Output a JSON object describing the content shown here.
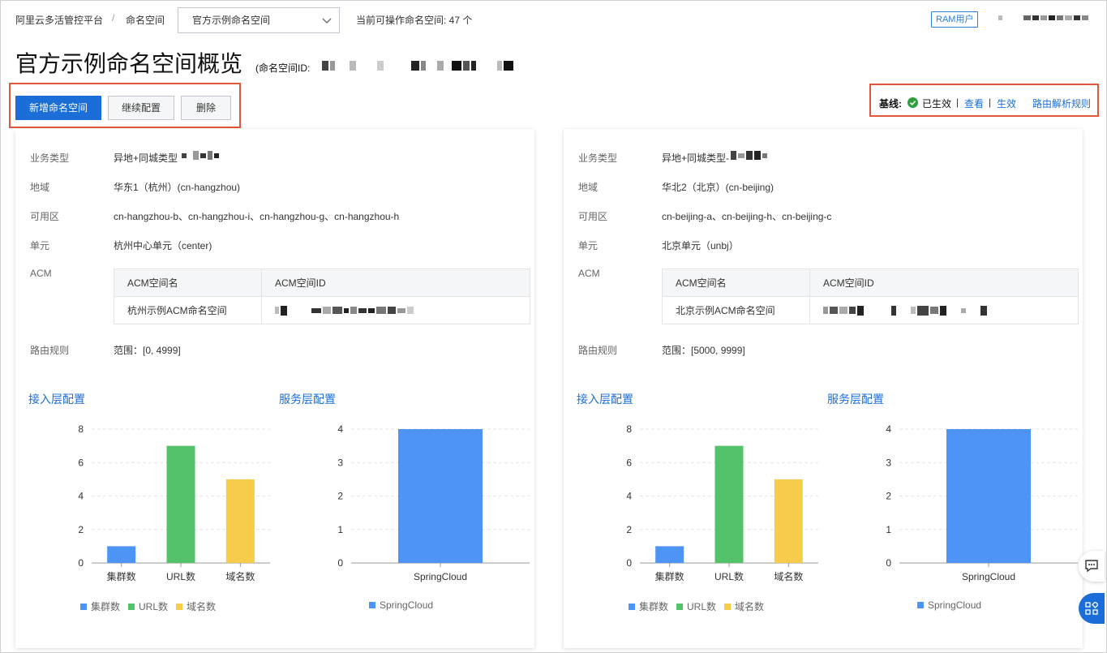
{
  "breadcrumb": {
    "platform": "阿里云多活管控平台",
    "separator": "/",
    "section": "命名空间"
  },
  "ns_select": {
    "value": "官方示例命名空间"
  },
  "count_label": "当前可操作命名空间: 47 个",
  "user": {
    "role_badge": "RAM用户"
  },
  "page_title": "官方示例命名空间概览",
  "ns_id_label": "(命名空间ID:",
  "actions": {
    "add": "新增命名空间",
    "continue": "继续配置",
    "delete": "删除"
  },
  "baseline": {
    "label": "基线:",
    "status": "已生效",
    "sep": "|",
    "view": "查看",
    "apply": "生效",
    "route_rules": "路由解析规则",
    "status_color": "#2e9e3e"
  },
  "labels": {
    "biz_type": "业务类型",
    "region": "地域",
    "zone": "可用区",
    "unit": "单元",
    "acm": "ACM",
    "route": "路由规则",
    "acm_name_col": "ACM空间名",
    "acm_id_col": "ACM空间ID",
    "access_title": "接入层配置",
    "service_title": "服务层配置"
  },
  "cards": [
    {
      "biz_type": "异地+同城类型",
      "region": "华东1（杭州）(cn-hangzhou)",
      "zone": "cn-hangzhou-b、cn-hangzhou-i、cn-hangzhou-g、cn-hangzhou-h",
      "unit": "杭州中心单元（center)",
      "acm_name": "杭州示例ACM命名空间",
      "route": "范围：[0, 4999]"
    },
    {
      "biz_type": "异地+同城类型-",
      "region": "华北2（北京）(cn-beijing)",
      "zone": "cn-beijing-a、cn-beijing-h、cn-beijing-c",
      "unit": "北京单元（unbj）",
      "acm_name": "北京示例ACM命名空间",
      "route": "范围：[5000, 9999]"
    }
  ],
  "chart_data": [
    {
      "type": "bar",
      "title": "接入层配置",
      "categories": [
        "集群数",
        "URL数",
        "域名数"
      ],
      "values": [
        1,
        7,
        5
      ],
      "yticks": [
        0,
        2,
        4,
        6,
        8
      ],
      "ylim": [
        0,
        8
      ],
      "colors": [
        "#4d94f5",
        "#53c26a",
        "#f7cc4a"
      ],
      "legend": [
        "集群数",
        "URL数",
        "域名数"
      ],
      "grid": true,
      "legend_position": "bottom"
    },
    {
      "type": "bar",
      "title": "服务层配置",
      "categories": [
        "SpringCloud"
      ],
      "values": [
        4
      ],
      "yticks": [
        0,
        1,
        2,
        3,
        4
      ],
      "ylim": [
        0,
        4
      ],
      "colors": [
        "#4d94f5"
      ],
      "legend": [
        "SpringCloud"
      ],
      "grid": true,
      "legend_position": "bottom"
    },
    {
      "type": "bar",
      "title": "接入层配置",
      "categories": [
        "集群数",
        "URL数",
        "域名数"
      ],
      "values": [
        1,
        7,
        5
      ],
      "yticks": [
        0,
        2,
        4,
        6,
        8
      ],
      "ylim": [
        0,
        8
      ],
      "colors": [
        "#4d94f5",
        "#53c26a",
        "#f7cc4a"
      ],
      "legend": [
        "集群数",
        "URL数",
        "域名数"
      ],
      "grid": true,
      "legend_position": "bottom"
    },
    {
      "type": "bar",
      "title": "服务层配置",
      "categories": [
        "SpringCloud"
      ],
      "values": [
        4
      ],
      "yticks": [
        0,
        1,
        2,
        3,
        4
      ],
      "ylim": [
        0,
        4
      ],
      "colors": [
        "#4d94f5"
      ],
      "legend": [
        "SpringCloud"
      ],
      "grid": true,
      "legend_position": "bottom"
    }
  ],
  "icons": {
    "chevron": "chevron-down-icon",
    "check": "check-circle-icon",
    "chat": "chat-icon",
    "apps": "apps-grid-icon"
  }
}
